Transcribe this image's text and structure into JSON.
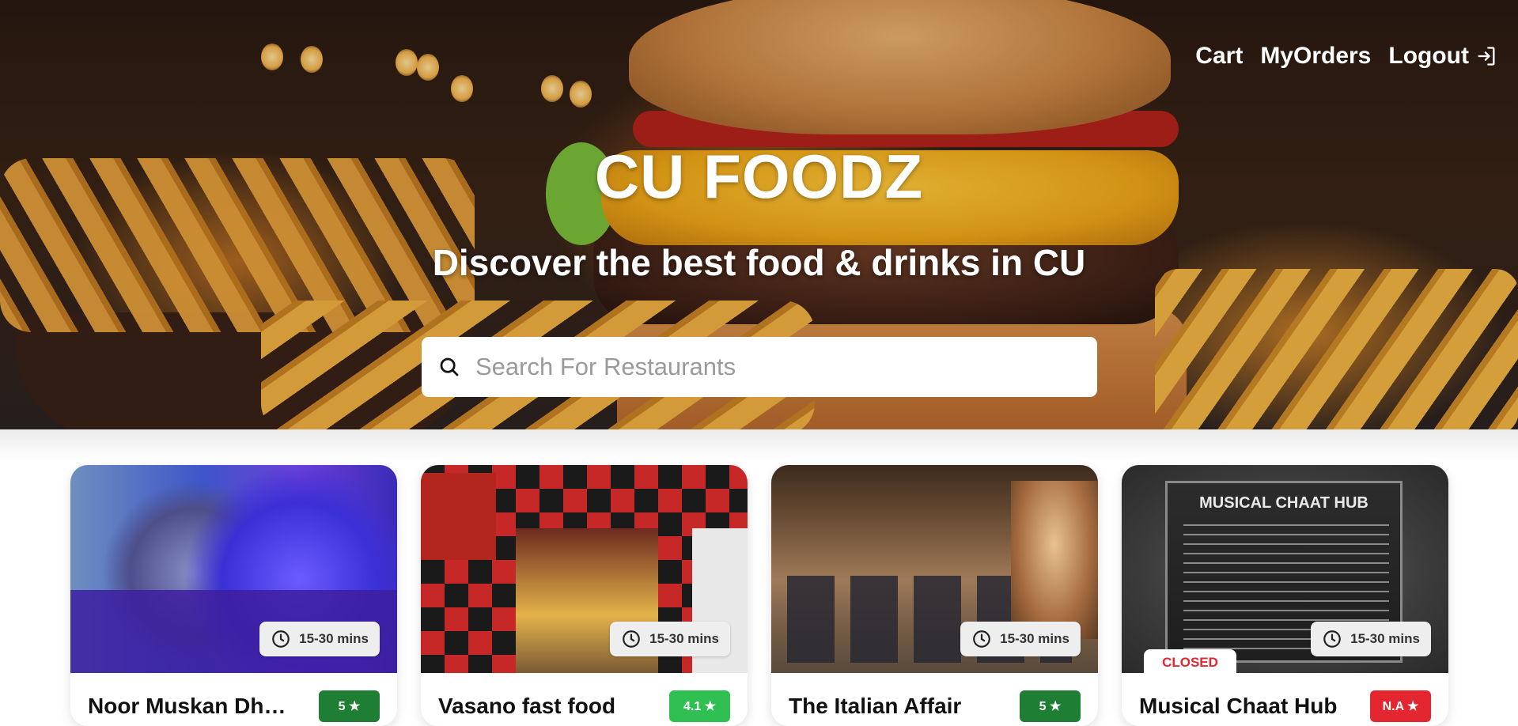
{
  "nav": {
    "cart": "Cart",
    "my_orders": "MyOrders",
    "logout": "Logout"
  },
  "hero": {
    "brand": "CU FOODZ",
    "tagline": "Discover the best food & drinks in CU"
  },
  "search": {
    "placeholder": "Search For Restaurants",
    "value": ""
  },
  "restaurants": [
    {
      "name": "Noor Muskan Dh…",
      "time": "15-30 mins",
      "rating": "5 ★",
      "rating_color": "#1e7e34",
      "status": ""
    },
    {
      "name": "Vasano fast food",
      "time": "15-30 mins",
      "rating": "4.1 ★",
      "rating_color": "#2fbf52",
      "status": ""
    },
    {
      "name": "The Italian Affair",
      "time": "15-30 mins",
      "rating": "5 ★",
      "rating_color": "#1e7e34",
      "status": ""
    },
    {
      "name": "Musical Chaat Hub",
      "time": "15-30 mins",
      "rating": "N.A ★",
      "rating_color": "#e3262f",
      "status": "CLOSED"
    }
  ],
  "image_text": {
    "musical_board_title": "MUSICAL CHAAT HUB"
  },
  "icons": {
    "logout": "logout-icon",
    "search": "search-icon",
    "clock": "clock-icon"
  }
}
